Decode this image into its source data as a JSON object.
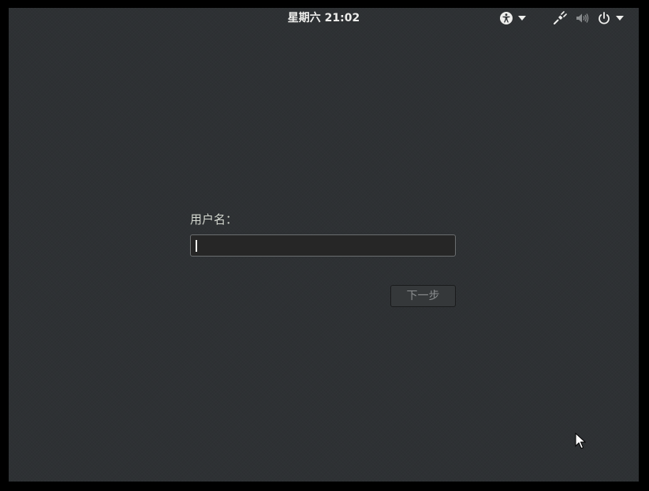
{
  "topbar": {
    "clock": "星期六 21:02",
    "icons": {
      "accessibility": "accessibility-icon",
      "network": "wired-network-icon",
      "volume": "volume-icon",
      "power": "power-icon",
      "menu_arrow": "chevron-down-icon"
    }
  },
  "login": {
    "username_label": "用户名：",
    "username_value": "",
    "next_label": "下一步"
  },
  "colors": {
    "background": "#2e3134",
    "text": "#eeeeec",
    "disabled_text": "#8a8d8f"
  }
}
